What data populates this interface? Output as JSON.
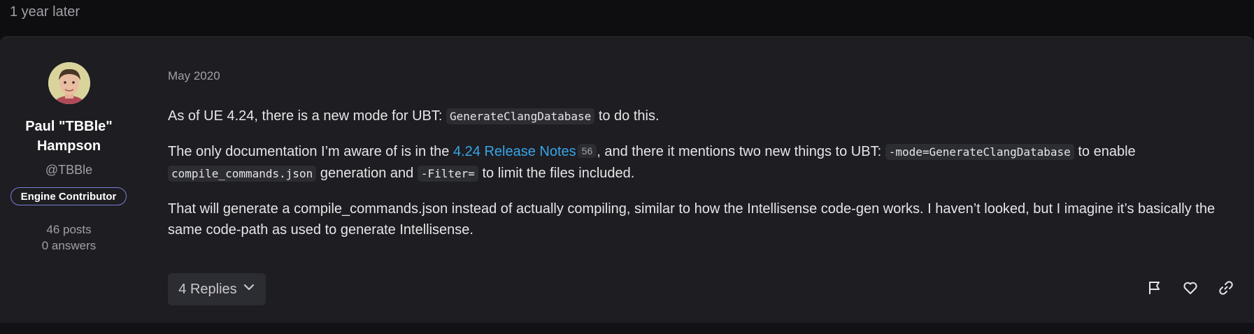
{
  "time_gap": {
    "label": "1 year later"
  },
  "author": {
    "name": "Paul \"TBBle\" Hampson",
    "handle": "@TBBle",
    "badge": "Engine Contributor",
    "posts": "46 posts",
    "answers": "0 answers"
  },
  "post": {
    "date": "May 2020",
    "p1_before": "As of UE 4.24, there is a new mode for UBT: ",
    "p1_code": "GenerateClangDatabase",
    "p1_after": " to do this.",
    "p2_before": "The only documentation I’m aware of is in the ",
    "p2_link": "4.24 Release Notes",
    "p2_link_count": "56",
    "p2_mid": ", and there it mentions two new things to UBT: ",
    "p2_code1": "-mode=GenerateClangDatabase",
    "p2_mid2": " to enable ",
    "p2_code2": "compile_commands.json",
    "p2_mid3": " generation and ",
    "p2_code3": "-Filter=",
    "p2_after": " to limit the files included.",
    "p3": "That will generate a compile_commands.json instead of actually compiling, similar to how the Intellisense code-gen works. I haven’t looked, but I imagine it’s basically the same code-path as used to generate Intellisense."
  },
  "footer": {
    "replies_label": "4 Replies"
  },
  "icons": {
    "flag": "flag-icon",
    "like": "heart-icon",
    "share": "link-icon",
    "chevron": "chevron-down-icon"
  },
  "colors": {
    "link": "#3aa5e6",
    "badge_border": "#7b7fd6",
    "card_bg": "#1d1d22"
  }
}
